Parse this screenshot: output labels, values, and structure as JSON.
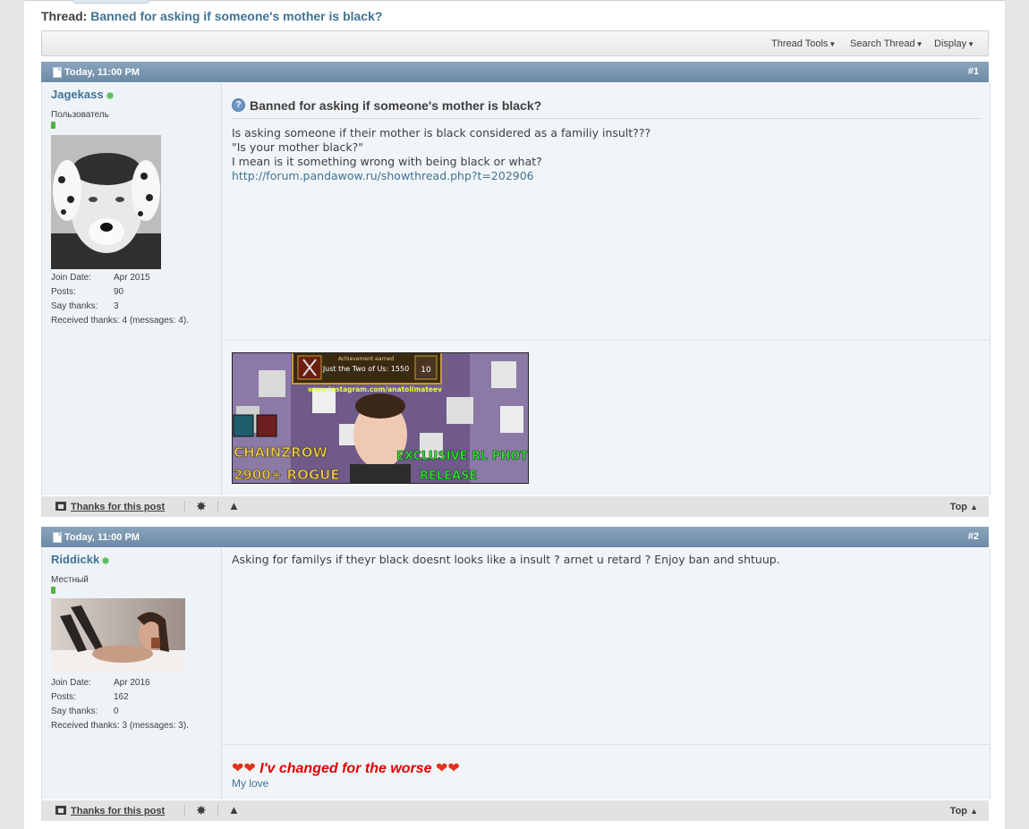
{
  "thread": {
    "label": "Thread:",
    "title": "Banned for asking if someone's mother is black?"
  },
  "toolbar": {
    "thread_tools": "Thread Tools",
    "search_thread": "Search Thread",
    "display": "Display"
  },
  "posts": [
    {
      "date": "Today, 11:00 PM",
      "number": "#1",
      "user": {
        "name": "Jagekass",
        "title": "Пользователь",
        "stats": [
          {
            "label": "Join Date:",
            "value": "Apr 2015"
          },
          {
            "label": "Posts:",
            "value": "90"
          },
          {
            "label": "Say thanks:",
            "value": "3"
          },
          {
            "label": "Received thanks:",
            "value": "4 (messages: 4)."
          }
        ]
      },
      "title": "Banned for asking if someone's mother is black?",
      "lines": [
        "Is asking someone if their mother is black considered as a familiy insult???",
        "\"Is your mother black?\"",
        "I mean is it something wrong with being black or what?"
      ],
      "link": "http://forum.pandawow.ru/showthread.php?t=202906",
      "signature_banner": {
        "achievement_header": "Achievement earned",
        "achievement": "Just the Two of Us: 1550",
        "achievement_badge": "10",
        "instagram": "www.instagram.com/anatolimateev",
        "left_text_1": "CHAINZROW",
        "left_text_2": "2900+ ROGUE",
        "right_text_1": "EXCLUSIVE RL PHOTO",
        "right_text_2": "RELEASE"
      },
      "footer": {
        "thanks": "Thanks for this post",
        "top": "Top"
      }
    },
    {
      "date": "Today, 11:00 PM",
      "number": "#2",
      "user": {
        "name": "Riddickk",
        "title": "Местный",
        "stats": [
          {
            "label": "Join Date:",
            "value": "Apr 2016"
          },
          {
            "label": "Posts:",
            "value": "162"
          },
          {
            "label": "Say thanks:",
            "value": "0"
          },
          {
            "label": "Received thanks:",
            "value": "3 (messages: 3)."
          }
        ]
      },
      "message": "Asking for familys if theyr black doesnt looks like a insult ? arnet u retard ? Enjoy ban and shtuup.",
      "signature": {
        "headline": "I'v changed for the worse",
        "subline": "My love"
      },
      "footer": {
        "thanks": "Thanks for this post",
        "top": "Top"
      }
    }
  ],
  "colors": {
    "header": "#7792ad",
    "link": "#417394",
    "signature_red": "#e00000",
    "online": "#5bbf5b"
  }
}
